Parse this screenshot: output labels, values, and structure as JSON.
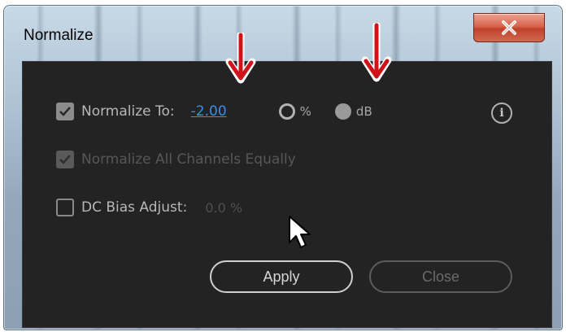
{
  "dialog": {
    "title": "Normalize",
    "close_glyph": "X"
  },
  "normalize_to": {
    "label": "Normalize To:",
    "checked": true,
    "value": "-2.00",
    "unit_options": [
      {
        "label": "%",
        "selected": false
      },
      {
        "label": "dB",
        "selected": true
      }
    ]
  },
  "normalize_all_channels": {
    "label": "Normalize All Channels Equally",
    "checked": true,
    "disabled": true
  },
  "dc_bias": {
    "label": "DC Bias Adjust:",
    "checked": false,
    "value": "0.0 %"
  },
  "buttons": {
    "apply_label": "Apply",
    "close_label": "Close"
  },
  "icons": {
    "info": "info-icon",
    "checkmark": "checkmark-icon",
    "cursor": "mouse-cursor-icon",
    "annotation_arrow": "red-down-arrow-icon"
  },
  "colors": {
    "panel_bg": "#232323",
    "link_value": "#3b8fe6",
    "annotation_arrow": "#d0121b"
  }
}
